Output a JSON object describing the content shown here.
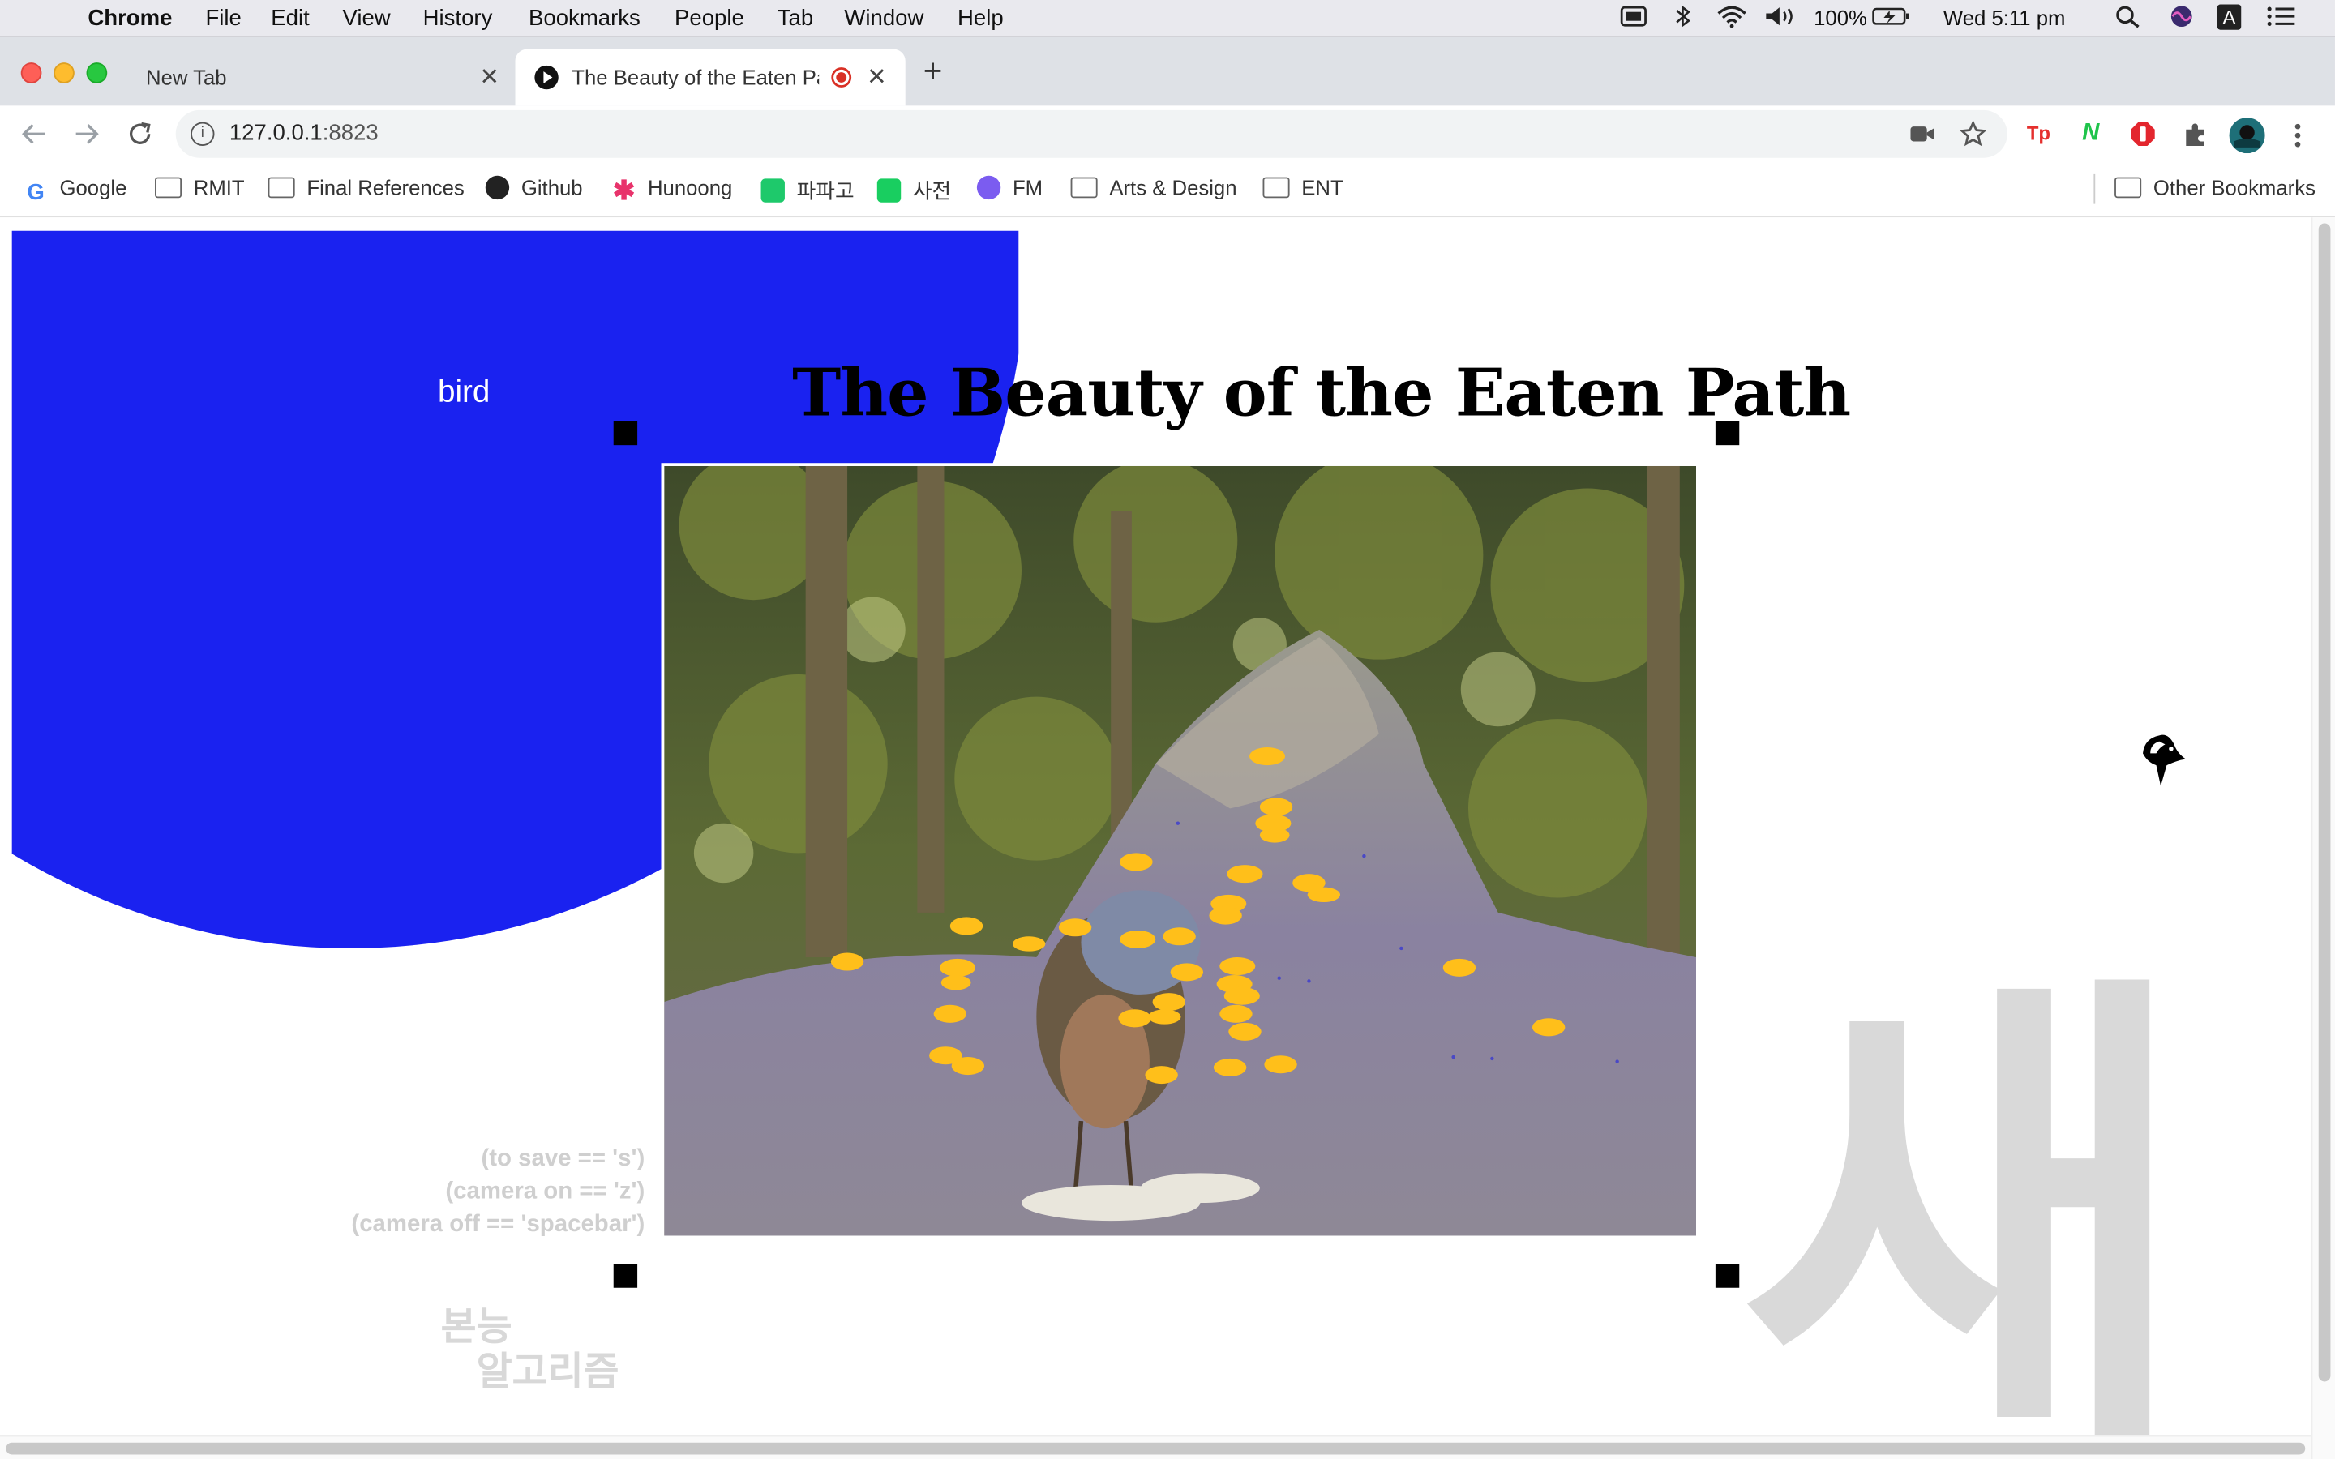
{
  "menubar": {
    "app": "Chrome",
    "items": [
      "File",
      "Edit",
      "View",
      "History",
      "Bookmarks",
      "People",
      "Tab",
      "Window",
      "Help"
    ],
    "battery": "100%",
    "clock": "Wed 5:11 pm",
    "input_indicator": "A"
  },
  "tabs": [
    {
      "label": "New Tab",
      "close": "✕"
    },
    {
      "label": "The Beauty of the Eaten Pa",
      "close": "✕"
    }
  ],
  "new_tab": "+",
  "omnibox": {
    "host": "127.0.0.1",
    "port": ":8823"
  },
  "extensions": [
    "Tp",
    "N"
  ],
  "bookmarks": {
    "items": [
      {
        "label": "Google",
        "icon": "google-icon"
      },
      {
        "label": "RMIT",
        "icon": "folder-icon"
      },
      {
        "label": "Final References",
        "icon": "folder-icon"
      },
      {
        "label": "Github",
        "icon": "github-icon"
      },
      {
        "label": "Hunoong",
        "icon": "asterisk-icon"
      },
      {
        "label": "파파고",
        "icon": "papago-icon"
      },
      {
        "label": "사전",
        "icon": "dictionary-icon"
      },
      {
        "label": "FM",
        "icon": "messenger-icon"
      },
      {
        "label": "Arts & Design",
        "icon": "folder-icon"
      },
      {
        "label": "ENT",
        "icon": "folder-icon"
      }
    ],
    "other": "Other Bookmarks"
  },
  "page": {
    "class_label": "bird",
    "title": "The Beauty of the Eaten Path",
    "hints": [
      "(to save == 's')",
      "(camera on == 'z')",
      "(camera off == 'spacebar')"
    ],
    "korean_line1": "본능",
    "korean_line2": "알고리즘",
    "korean_big": "새",
    "accent_blue": "#1a22f0",
    "dot_color": "#ffbf1a"
  }
}
